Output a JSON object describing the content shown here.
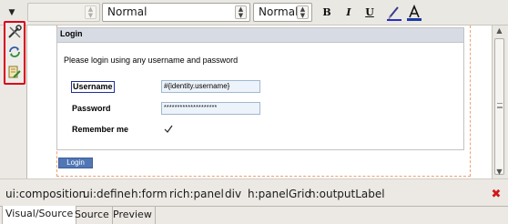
{
  "toolbar": {
    "font_family_value": "",
    "paragraph_style": "Normal",
    "font_size": "Normal",
    "bold_label": "B",
    "italic_label": "I",
    "underline_label": "U",
    "buttons": [
      "dropdown-arrow-icon",
      "bold",
      "italic",
      "underline",
      "highlight-pen-icon",
      "text-color-icon"
    ]
  },
  "palette": {
    "icons": [
      "tools-icon",
      "refresh-arrows-icon",
      "edit-page-icon"
    ],
    "highlight_color": "#d9001b"
  },
  "panel": {
    "title": "Login",
    "intro": "Please login using any username and password",
    "username_label": "Username",
    "username_value": "#{identity.username}",
    "password_label": "Password",
    "password_value": "********************",
    "remember_label": "Remember me",
    "remember_checked": true,
    "header_color": "#d7dbe4"
  },
  "login_button": {
    "label": "Login",
    "color": "#5076b5"
  },
  "breadcrumb": {
    "items": [
      "ui:composition",
      "ui:define",
      "h:form",
      "rich:panel",
      "div",
      "h:panelGrid",
      "h:outputLabel"
    ]
  },
  "tabs": [
    {
      "label": "Visual/Source",
      "active": true
    },
    {
      "label": "Source",
      "active": false
    },
    {
      "label": "Preview",
      "active": false
    }
  ]
}
